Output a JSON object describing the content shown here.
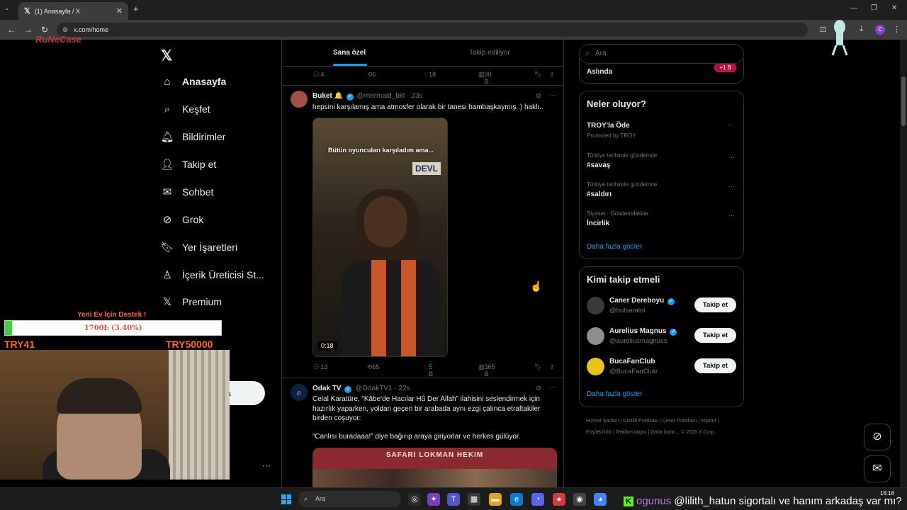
{
  "browser": {
    "tab_title": "(1) Anasayfa / X",
    "url": "x.com/home",
    "profile_initial": "C"
  },
  "stream": {
    "brand": "RuNeCase",
    "donation_title": "Yeni Ev İçin Destek !",
    "donation_amount": "1700₺ (3.40%)",
    "donation_progress": 0.034,
    "donation_min": "TRY41",
    "donation_max": "TRY50000",
    "chat_user": "ogunus",
    "chat_message": "@lilith_hatun sigortalı ve hanım arkadaş var mı?"
  },
  "nav": {
    "items": [
      {
        "label": "Anasayfa",
        "icon": "home-icon",
        "glyph": "⌂"
      },
      {
        "label": "Keşfet",
        "icon": "search-icon",
        "glyph": "⌕"
      },
      {
        "label": "Bildirimler",
        "icon": "bell-icon",
        "glyph": "🔔︎"
      },
      {
        "label": "Takip et",
        "icon": "follow-icon",
        "glyph": "👤︎"
      },
      {
        "label": "Sohbet",
        "icon": "mail-icon",
        "glyph": "✉"
      },
      {
        "label": "Grok",
        "icon": "grok-icon",
        "glyph": "⊘"
      },
      {
        "label": "Yer İşaretleri",
        "icon": "bookmark-icon",
        "glyph": "🔖︎"
      },
      {
        "label": "İçerik Üreticisi St...",
        "icon": "creator-studio-icon",
        "glyph": "♙"
      },
      {
        "label": "Premium",
        "icon": "x-premium-icon",
        "glyph": "𝕏"
      }
    ],
    "post_button": "nla"
  },
  "feed": {
    "tabs": [
      "Sana özel",
      "Takip ediliyor"
    ],
    "top_actions": {
      "replies": "4",
      "reposts": "6",
      "likes": "18",
      "views": "90 B"
    },
    "tweet1": {
      "name": "Buket 🔔",
      "handle": "@mermaid_bkt · 23s",
      "text": "hepsini karşılamış ama atmosfer olarak bir tanesi bambaşkaymış :) haklı..",
      "video_caption": "Bütün oyuncuları karşıladım ama...",
      "video_sign": "DEVL",
      "duration": "0:18",
      "actions": {
        "replies": "13",
        "reposts": "65",
        "likes": "5 B",
        "views": "365 B"
      }
    },
    "tweet2": {
      "name": "Odak TV",
      "handle": "@OdakTV1 · 22s",
      "text": "Celal Karatüre, “Kâbe'de Hacılar Hû Der Allah” ilahisini seslendirmek için hazırlık yaparken, yoldan geçen bir arabada aynı ezgi çalınca etraftakiler birden coşuyor:",
      "text2": "“Canlısı buradaaa!” diye bağırıp araya giriyorlar ve herkes gülüyor.",
      "image_sign": "SAFARI LOKMAN HEKIM"
    }
  },
  "right": {
    "search_placeholder": "Ara",
    "live_title": "Aslında",
    "live_badge": "+1 B",
    "trends_title": "Neler oluyor?",
    "trends": [
      {
        "meta": "Promoted by TROY",
        "name": "TROY'la Öde"
      },
      {
        "meta": "Türkiye tarihinde gündemde",
        "name": "#savaş"
      },
      {
        "meta": "Türkiye tarihinde gündemde",
        "name": "#saldırı"
      },
      {
        "meta": "Siyaset · Gündemdekiler",
        "name": "İncirlik"
      }
    ],
    "show_more": "Daha fazla göster",
    "who_title": "Kimi takip etmeli",
    "who": [
      {
        "name": "Caner Dereboyu",
        "handle": "@bulsaralol"
      },
      {
        "name": "Aurelius Magnus",
        "handle": "@aureliusmagnuss"
      },
      {
        "name": "BucaFanClub",
        "handle": "@BucaFanClub"
      }
    ],
    "follow_label": "Takip et",
    "footer": "Hizmet Şartları | Gizlilik Politikası | Çerez Politikası | Imprint | Erişilebilirlik | Reklam bilgisi | Daha fazla ... © 2026 X Corp."
  },
  "taskbar": {
    "search": "Ara",
    "time": "16:16"
  }
}
